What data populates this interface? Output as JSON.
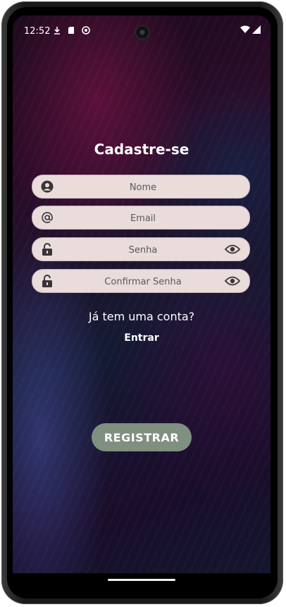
{
  "status_bar": {
    "time": "12:52"
  },
  "screen": {
    "title": "Cadastre-se",
    "fields": [
      {
        "placeholder": "Nome",
        "icon": "person-icon",
        "type": "text"
      },
      {
        "placeholder": "Email",
        "icon": "at-icon",
        "type": "email"
      },
      {
        "placeholder": "Senha",
        "icon": "unlock-icon",
        "type": "password",
        "toggle": "eye-icon"
      },
      {
        "placeholder": "Confirmar Senha",
        "icon": "unlock-icon",
        "type": "password",
        "toggle": "eye-icon"
      }
    ],
    "login_prompt": "Já tem uma conta?",
    "login_link": "Entrar",
    "register_button": "REGISTRAR"
  },
  "colors": {
    "field_bg": "#e9dcda",
    "button_bg": "#7f8f80",
    "text": "#ffffff"
  }
}
